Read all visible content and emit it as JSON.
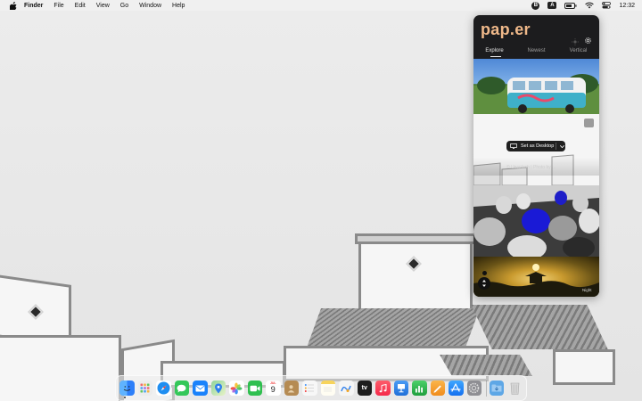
{
  "menubar": {
    "app_name": "Finder",
    "items": [
      "File",
      "Edit",
      "View",
      "Go",
      "Window",
      "Help"
    ],
    "status_b": "B",
    "status_a": "A",
    "clock": "12:32"
  },
  "panel": {
    "logo": "pap.er",
    "tabs": [
      "Explore",
      "Newest",
      "Vertical"
    ],
    "active_tab": "Explore",
    "set_desktop_label": "Set as Desktop",
    "credit_text": "© Unsplash | Photo by ...",
    "corner_tag": "Night"
  },
  "dock": {
    "apps": [
      {
        "name": "finder-icon",
        "color": "#2d7ff9"
      },
      {
        "name": "launchpad-icon",
        "color": "#e9e9e9"
      },
      {
        "name": "safari-icon",
        "color": "#1f8ef1"
      },
      {
        "name": "messages-icon",
        "color": "#34c759"
      },
      {
        "name": "mail-icon",
        "color": "#1a82fb"
      },
      {
        "name": "maps-icon",
        "color": "#6fc276"
      },
      {
        "name": "photos-icon",
        "color": "#f4a73b"
      },
      {
        "name": "facetime-icon",
        "color": "#2fbf4f"
      },
      {
        "name": "calendar-icon",
        "color": "#ffffff"
      },
      {
        "name": "contacts-icon",
        "color": "#b58b53"
      },
      {
        "name": "reminders-icon",
        "color": "#f2f2f2"
      },
      {
        "name": "notes-icon",
        "color": "#f7e27a"
      },
      {
        "name": "freeform-icon",
        "color": "#f5f5f5"
      },
      {
        "name": "tv-icon",
        "color": "#1c1c1c"
      },
      {
        "name": "music-icon",
        "color": "#fa3e4b"
      },
      {
        "name": "keynote-icon",
        "color": "#2f7ee6"
      },
      {
        "name": "numbers-icon",
        "color": "#32b34a"
      },
      {
        "name": "pages-icon",
        "color": "#f5a623"
      },
      {
        "name": "app-store-icon",
        "color": "#1e88f7"
      },
      {
        "name": "system-settings-icon",
        "color": "#8e8e93"
      },
      {
        "name": "downloads-folder-icon",
        "color": "#5ea7e6"
      },
      {
        "name": "trash-icon",
        "color": "#d7d7d7"
      }
    ],
    "calendar_month": "JUL",
    "calendar_day": "9",
    "tv_label": "tv"
  }
}
